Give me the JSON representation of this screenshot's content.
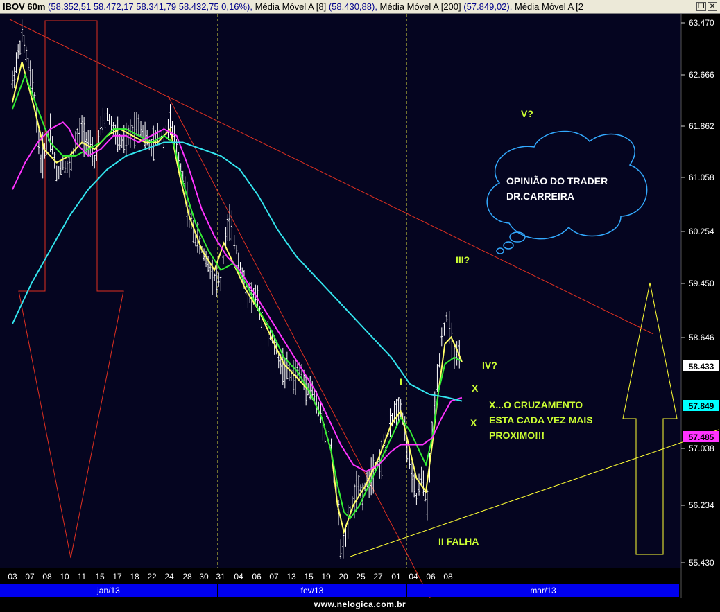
{
  "title": {
    "asset": "IBOV 60m",
    "ohlc": "(58.352,51   58.472,17   58.341,79   58.432,75   0,16%),",
    "ma8_label": " Média Móvel A [8]",
    "ma8_value": "(58.430,88),",
    "ma200_label": " Média Móvel A [200]",
    "ma200_value": "(57.849,02),",
    "ma_extra_label": " Média Móvel A [2"
  },
  "footer": {
    "site": "www.nelogica.com.br"
  },
  "colors": {
    "background": "#050520",
    "price": "#ffffff",
    "ma_fast": "#ffff66",
    "ma_mid": "#33ee33",
    "ma_slow": "#ff33ff",
    "ma_200": "#33e5ee",
    "downtrend": "#e03020",
    "uptrend": "#ffff33",
    "annotation": "#ccff33",
    "month_bar": "#0000ee"
  },
  "chart_data": {
    "type": "candlestick",
    "title": "IBOV 60m",
    "y_ticks": [
      "63.470",
      "62.666",
      "61.862",
      "61.058",
      "60.254",
      "59.450",
      "58.646",
      "57.038",
      "56.234",
      "55.430"
    ],
    "y_tick_values": [
      63470,
      62666,
      61862,
      61058,
      60254,
      59450,
      58646,
      57038,
      56234,
      55430
    ],
    "ylim": [
      55430,
      63470
    ],
    "x_ticks": [
      "03",
      "07",
      "08",
      "10",
      "11",
      "15",
      "17",
      "18",
      "22",
      "24",
      "28",
      "30",
      "31",
      "04",
      "06",
      "07",
      "13",
      "15",
      "19",
      "20",
      "25",
      "27",
      "01",
      "04",
      "06",
      "08"
    ],
    "months": [
      "jan/13",
      "fev/13",
      "mar/13"
    ],
    "price_path": [
      [
        0,
        62600
      ],
      [
        1.5,
        63300
      ],
      [
        3.5,
        62400
      ],
      [
        4.5,
        61400
      ],
      [
        6,
        61900
      ],
      [
        7,
        61200
      ],
      [
        8,
        61400
      ],
      [
        9,
        61300
      ],
      [
        10,
        61700
      ],
      [
        11,
        61900
      ],
      [
        12,
        61700
      ],
      [
        13,
        61400
      ],
      [
        14,
        61900
      ],
      [
        15,
        62100
      ],
      [
        16,
        61900
      ],
      [
        17,
        61700
      ],
      [
        18,
        61700
      ],
      [
        19,
        61900
      ],
      [
        20,
        62000
      ],
      [
        21,
        61800
      ],
      [
        22,
        61600
      ],
      [
        23,
        61800
      ],
      [
        24,
        61800
      ],
      [
        25,
        62000
      ],
      [
        26,
        61600
      ],
      [
        27,
        61200
      ],
      [
        28,
        60600
      ],
      [
        29,
        60300
      ],
      [
        30,
        60100
      ],
      [
        31,
        59900
      ],
      [
        32,
        59700
      ],
      [
        33,
        59600
      ],
      [
        33.8,
        60300
      ],
      [
        34.4,
        60500
      ],
      [
        35.5,
        60100
      ],
      [
        37,
        59500
      ],
      [
        38.5,
        59400
      ],
      [
        39.5,
        59100
      ],
      [
        40.5,
        58900
      ],
      [
        41.5,
        58700
      ],
      [
        42.5,
        58400
      ],
      [
        43.5,
        58300
      ],
      [
        44.5,
        58200
      ],
      [
        45.5,
        58300
      ],
      [
        46.5,
        58100
      ],
      [
        47.5,
        58000
      ],
      [
        48.5,
        57700
      ],
      [
        49.5,
        57500
      ],
      [
        50.5,
        57200
      ],
      [
        51.3,
        56500
      ],
      [
        52,
        55700
      ],
      [
        52.8,
        55800
      ],
      [
        53.5,
        56200
      ],
      [
        54.5,
        56500
      ],
      [
        55.5,
        56500
      ],
      [
        56.5,
        56700
      ],
      [
        57.5,
        56900
      ],
      [
        58.5,
        57000
      ],
      [
        59.5,
        57300
      ],
      [
        60.5,
        57700
      ],
      [
        61.5,
        57800
      ],
      [
        62.5,
        57200
      ],
      [
        63.3,
        56700
      ],
      [
        64,
        56400
      ],
      [
        64.8,
        56700
      ],
      [
        65.7,
        56300
      ],
      [
        66.5,
        57400
      ],
      [
        67.3,
        58200
      ],
      [
        68,
        58800
      ],
      [
        68.8,
        59100
      ],
      [
        69.6,
        58700
      ],
      [
        70.4,
        58500
      ],
      [
        71.2,
        58400
      ]
    ],
    "series": [
      {
        "name": "Média Móvel A [8]",
        "color": "#ffff66",
        "points": [
          [
            0,
            62300
          ],
          [
            1.5,
            62900
          ],
          [
            3.5,
            62200
          ],
          [
            5,
            61600
          ],
          [
            7,
            61400
          ],
          [
            9,
            61500
          ],
          [
            11,
            61700
          ],
          [
            13,
            61600
          ],
          [
            15,
            61800
          ],
          [
            17,
            61900
          ],
          [
            19,
            61800
          ],
          [
            21,
            61700
          ],
          [
            23,
            61700
          ],
          [
            25,
            61900
          ],
          [
            26.5,
            61200
          ],
          [
            28,
            60600
          ],
          [
            30,
            60100
          ],
          [
            32,
            59800
          ],
          [
            33.5,
            60200
          ],
          [
            35,
            59900
          ],
          [
            37,
            59500
          ],
          [
            39,
            59200
          ],
          [
            41,
            58800
          ],
          [
            43,
            58400
          ],
          [
            45,
            58200
          ],
          [
            47,
            58000
          ],
          [
            49,
            57600
          ],
          [
            50.5,
            57100
          ],
          [
            51.5,
            56300
          ],
          [
            52.5,
            55900
          ],
          [
            54,
            56300
          ],
          [
            56,
            56600
          ],
          [
            58,
            57000
          ],
          [
            60,
            57500
          ],
          [
            61.5,
            57700
          ],
          [
            62.5,
            57300
          ],
          [
            64,
            56700
          ],
          [
            65.5,
            56500
          ],
          [
            66.5,
            57200
          ],
          [
            67.5,
            58000
          ],
          [
            68.5,
            58700
          ],
          [
            69.5,
            58800
          ],
          [
            70.5,
            58600
          ],
          [
            71.2,
            58430
          ]
        ]
      },
      {
        "name": "",
        "color": "#33ee33",
        "points": [
          [
            0,
            62200
          ],
          [
            2,
            62700
          ],
          [
            4,
            62200
          ],
          [
            6,
            61700
          ],
          [
            8,
            61500
          ],
          [
            10,
            61500
          ],
          [
            12,
            61600
          ],
          [
            14,
            61700
          ],
          [
            16,
            61900
          ],
          [
            18,
            61900
          ],
          [
            20,
            61800
          ],
          [
            22,
            61700
          ],
          [
            24,
            61800
          ],
          [
            25.5,
            61700
          ],
          [
            27,
            61100
          ],
          [
            29,
            60500
          ],
          [
            31,
            60100
          ],
          [
            33,
            59800
          ],
          [
            35,
            59900
          ],
          [
            37,
            59600
          ],
          [
            39,
            59200
          ],
          [
            41,
            58900
          ],
          [
            43,
            58500
          ],
          [
            45,
            58300
          ],
          [
            47,
            58000
          ],
          [
            49,
            57600
          ],
          [
            50.5,
            57100
          ],
          [
            51.5,
            56600
          ],
          [
            52.5,
            56200
          ],
          [
            53.5,
            56100
          ],
          [
            55,
            56300
          ],
          [
            57,
            56700
          ],
          [
            59,
            57100
          ],
          [
            60.5,
            57400
          ],
          [
            61.5,
            57600
          ],
          [
            63,
            57400
          ],
          [
            64.5,
            57100
          ],
          [
            65.5,
            56900
          ],
          [
            66.5,
            57300
          ],
          [
            67.5,
            58000
          ],
          [
            68.5,
            58400
          ],
          [
            70,
            58500
          ],
          [
            71,
            58450
          ]
        ]
      },
      {
        "name": "",
        "color": "#ff33ff",
        "points": [
          [
            0,
            61000
          ],
          [
            2,
            61400
          ],
          [
            4,
            61700
          ],
          [
            6,
            61900
          ],
          [
            8,
            62000
          ],
          [
            9,
            61900
          ],
          [
            10,
            61700
          ],
          [
            12,
            61500
          ],
          [
            14,
            61600
          ],
          [
            16,
            61800
          ],
          [
            18,
            61800
          ],
          [
            20,
            61700
          ],
          [
            22,
            61800
          ],
          [
            24,
            61900
          ],
          [
            26,
            61800
          ],
          [
            28,
            61300
          ],
          [
            30,
            60700
          ],
          [
            32,
            60300
          ],
          [
            34,
            60000
          ],
          [
            36,
            59800
          ],
          [
            38,
            59500
          ],
          [
            40,
            59200
          ],
          [
            42,
            58900
          ],
          [
            44,
            58600
          ],
          [
            46,
            58300
          ],
          [
            48,
            58000
          ],
          [
            50,
            57600
          ],
          [
            52,
            57200
          ],
          [
            54,
            56900
          ],
          [
            56,
            56800
          ],
          [
            58,
            56900
          ],
          [
            60,
            57100
          ],
          [
            61.5,
            57200
          ],
          [
            63,
            57200
          ],
          [
            65,
            57200
          ],
          [
            66.5,
            57300
          ],
          [
            68,
            57600
          ],
          [
            69.5,
            57850
          ],
          [
            71.2,
            57900
          ]
        ]
      },
      {
        "name": "Média Móvel A [200]",
        "color": "#33e5ee",
        "points": [
          [
            0,
            59000
          ],
          [
            3,
            59600
          ],
          [
            6,
            60100
          ],
          [
            9,
            60600
          ],
          [
            12,
            61000
          ],
          [
            15,
            61300
          ],
          [
            18,
            61500
          ],
          [
            21,
            61600
          ],
          [
            24,
            61700
          ],
          [
            27,
            61700
          ],
          [
            30,
            61600
          ],
          [
            33,
            61500
          ],
          [
            36,
            61300
          ],
          [
            39,
            60900
          ],
          [
            42,
            60400
          ],
          [
            45,
            60000
          ],
          [
            48,
            59700
          ],
          [
            51,
            59400
          ],
          [
            54,
            59100
          ],
          [
            57,
            58800
          ],
          [
            60,
            58500
          ],
          [
            63,
            58100
          ],
          [
            66,
            57950
          ],
          [
            69,
            57900
          ],
          [
            71.2,
            57849
          ]
        ]
      }
    ],
    "badges": [
      {
        "label": "58.433",
        "value": 58433,
        "fill": "#ffffff",
        "text": "#000000"
      },
      {
        "label": "57.849",
        "value": 57849,
        "fill": "#00ffff",
        "text": "#000000"
      },
      {
        "label": "57.485",
        "value": 57485,
        "fill": "#ff33ff",
        "text": "#000000"
      }
    ],
    "annotations": {
      "wave_labels": [
        {
          "text": "V?"
        },
        {
          "text": "III?"
        },
        {
          "text": "IV?"
        },
        {
          "text": "I"
        },
        {
          "text": "II FALHA"
        },
        {
          "text": "X"
        },
        {
          "text": "X"
        }
      ],
      "cloud_lines": [
        "OPINIÃO DO TRADER",
        "DR.CARREIRA"
      ],
      "note_lines": [
        "X...O CRUZAMENTO",
        "ESTA CADA VEZ MAIS",
        "PROXIMO!!!"
      ]
    }
  }
}
